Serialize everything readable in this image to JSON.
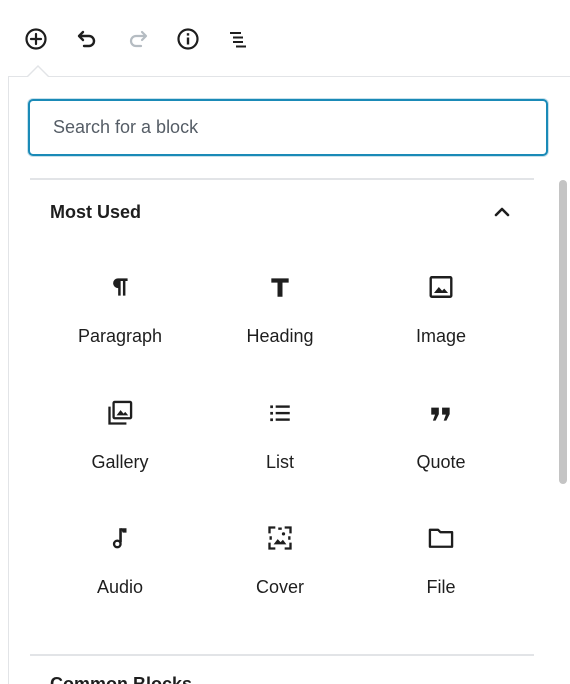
{
  "toolbar": {
    "buttons": [
      {
        "name": "add-block",
        "icon": "plus-circle-icon"
      },
      {
        "name": "undo",
        "icon": "undo-icon"
      },
      {
        "name": "redo",
        "icon": "redo-icon",
        "disabled": true
      },
      {
        "name": "info",
        "icon": "info-icon"
      },
      {
        "name": "outline",
        "icon": "block-navigation-icon"
      }
    ]
  },
  "inserter": {
    "search": {
      "placeholder": "Search for a block",
      "value": ""
    },
    "panels": [
      {
        "title": "Most Used",
        "expanded": true,
        "toggle_icon": "chevron-up-icon",
        "blocks": [
          {
            "label": "Paragraph",
            "icon": "paragraph-icon"
          },
          {
            "label": "Heading",
            "icon": "heading-icon"
          },
          {
            "label": "Image",
            "icon": "image-icon"
          },
          {
            "label": "Gallery",
            "icon": "gallery-icon"
          },
          {
            "label": "List",
            "icon": "list-icon"
          },
          {
            "label": "Quote",
            "icon": "quote-icon"
          },
          {
            "label": "Audio",
            "icon": "audio-icon"
          },
          {
            "label": "Cover",
            "icon": "cover-icon"
          },
          {
            "label": "File",
            "icon": "file-icon"
          }
        ]
      },
      {
        "title": "Common Blocks",
        "expanded": false
      }
    ]
  },
  "colors": {
    "accent": "#1a8ab7",
    "text": "#1e1e1e",
    "disabled": "#b5bcc2",
    "border": "#e2e4e7"
  }
}
